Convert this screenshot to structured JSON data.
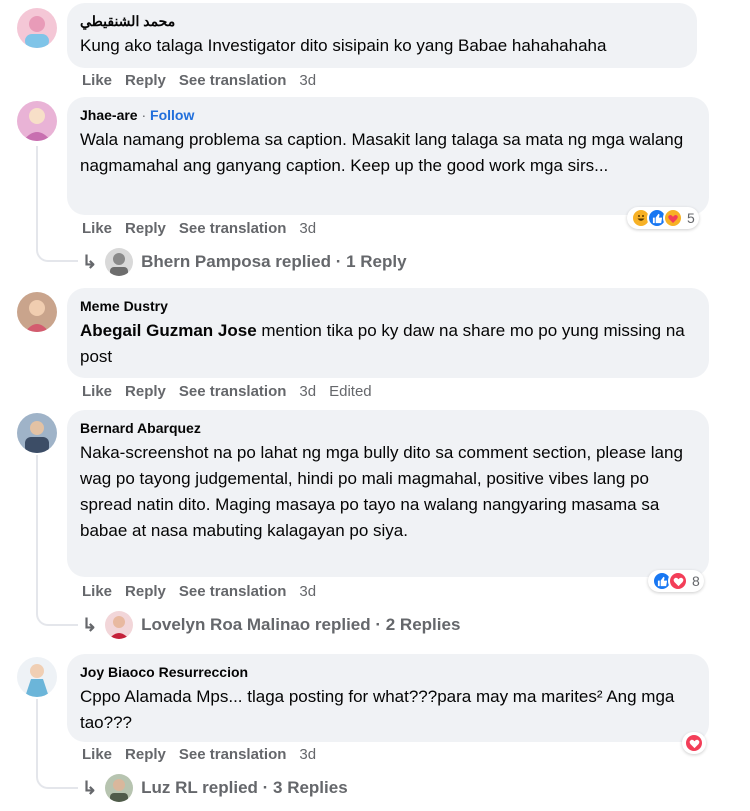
{
  "actions": {
    "like": "Like",
    "reply": "Reply",
    "translate": "See translation"
  },
  "comments": [
    {
      "author": "محمد الشنقيطي",
      "text": "Kung ako talaga Investigator dito sisipain ko yang Babae hahahahaha",
      "time": "3d"
    },
    {
      "author": "Jhae-are",
      "follow_sep": " · ",
      "follow": "Follow",
      "text": "Wala namang problema sa caption. Masakit lang talaga sa mata ng mga walang nagmamahal ang ganyang caption. Keep up the good work mga sirs...",
      "time": "3d",
      "reaction_count": "5",
      "reply_summary": "Bhern Pamposa replied · 1 Reply"
    },
    {
      "author": "Meme Dustry",
      "mention": "Abegail Guzman Jose",
      "text": " mention tika po ky daw na share mo po yung missing na post",
      "time": "3d",
      "edited": "Edited"
    },
    {
      "author": "Bernard Abarquez",
      "text": "Naka-screenshot na po lahat ng mga bully dito sa comment section, please lang wag po tayong judgemental, hindi po mali magmahal, positive vibes lang po spread natin dito. Maging masaya po tayo na walang nangyaring masama sa babae at nasa mabuting kalagayan po siya.",
      "time": "3d",
      "reaction_count": "8",
      "reply_summary": "Lovelyn Roa Malinao replied · 2 Replies"
    },
    {
      "author": "Joy Biaoco Resurreccion",
      "text": "Cppo Alamada Mps... tlaga posting for what???para may ma marites² Ang mga tao???",
      "time": "3d",
      "reply_summary": "Luz RL replied · 3 Replies"
    }
  ],
  "colors": {
    "bubble": "#f0f2f5",
    "meta_text": "#65676b",
    "follow": "#216fdb",
    "like_blue": "#1877f2",
    "love_red": "#f33e58",
    "haha_yellow": "#f7b125"
  },
  "icons": {
    "reply_arrow": "reply-arrow-icon",
    "like": "like-reaction-icon",
    "love": "love-reaction-icon",
    "haha": "haha-reaction-icon",
    "care": "care-reaction-icon"
  }
}
